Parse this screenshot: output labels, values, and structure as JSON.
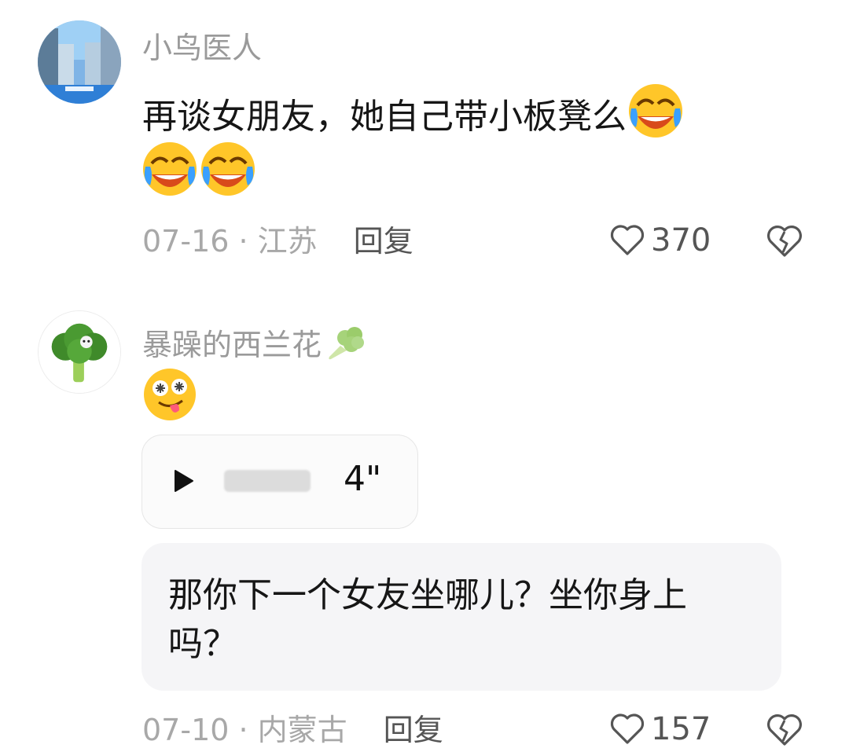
{
  "comments": [
    {
      "username": "小鸟医人",
      "text": "再谈女朋友，她自己带小板凳么",
      "emoji_after": [
        "laughing-tears-emoji",
        "laughing-tears-emoji",
        "laughing-tears-emoji"
      ],
      "date": "07-16",
      "location": "江苏",
      "reply_label": "回复",
      "likes": "370"
    },
    {
      "username": "暴躁的西兰花",
      "name_emoji": "broccoli-emoji",
      "emoji": "dizzy-tongue-emoji",
      "voice_duration": "4\"",
      "reply_text": "那你下一个女友坐哪儿？坐你身上吗？",
      "date": "07-10",
      "location": "内蒙古",
      "reply_label": "回复",
      "likes": "157"
    }
  ],
  "meta_separator": " · ",
  "colors": {
    "username": "#9a9a9a",
    "meta": "#a8a8a8",
    "bubble_bg": "#f5f5f7"
  }
}
